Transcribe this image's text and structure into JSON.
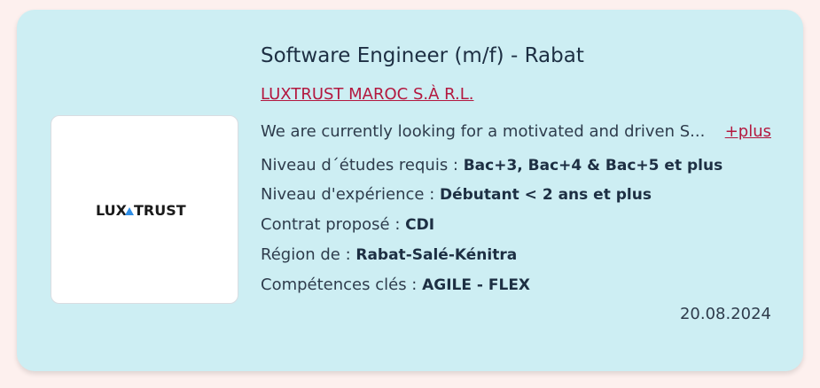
{
  "job": {
    "title": "Software Engineer (m/f) - Rabat",
    "company": "LUXTRUST MAROC S.À R.L.",
    "description": "We are currently looking for a motivated and driven S...",
    "more_label": "+plus",
    "date": "20.08.2024"
  },
  "logo": {
    "text_left": "LUX",
    "text_right": "TRUST",
    "accent_color": "#2f8ee6"
  },
  "details": [
    {
      "label": "Niveau d´études requis : ",
      "value": "Bac+3, Bac+4 & Bac+5 et plus"
    },
    {
      "label": "Niveau d'expérience : ",
      "value": "Débutant < 2 ans et plus"
    },
    {
      "label": "Contrat proposé : ",
      "value": "CDI"
    },
    {
      "label": "Région de : ",
      "value": "Rabat-Salé-Kénitra"
    },
    {
      "label": "Compétences clés : ",
      "value": "AGILE - FLEX"
    }
  ],
  "colors": {
    "page_bg": "#fdf0ee",
    "card_bg": "#cdeef3",
    "link": "#b3183f",
    "title": "#1d2f43"
  }
}
